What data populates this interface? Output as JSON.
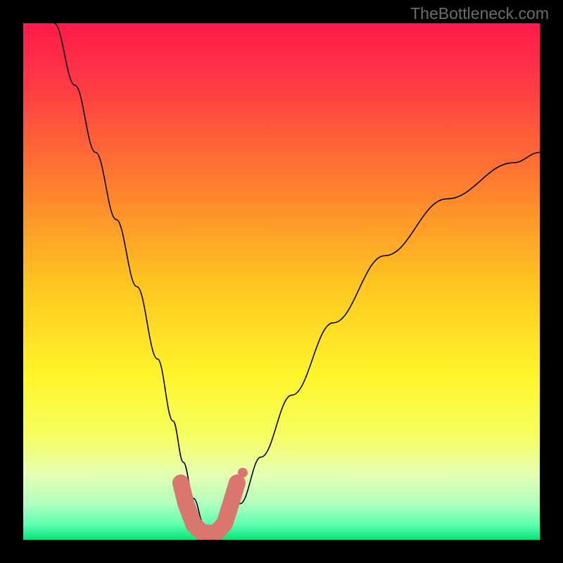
{
  "watermark": "TheBottleneck.com",
  "chart_data": {
    "type": "line",
    "title": "",
    "xlabel": "",
    "ylabel": "",
    "xlim": [
      0,
      100
    ],
    "ylim": [
      0,
      100
    ],
    "background_gradient": {
      "stops": [
        {
          "offset": 0.0,
          "color": "#ff1a4a"
        },
        {
          "offset": 0.12,
          "color": "#ff3a45"
        },
        {
          "offset": 0.3,
          "color": "#ff7a30"
        },
        {
          "offset": 0.5,
          "color": "#ffc420"
        },
        {
          "offset": 0.68,
          "color": "#fff52a"
        },
        {
          "offset": 0.8,
          "color": "#f5ff60"
        },
        {
          "offset": 0.87,
          "color": "#e8ffb0"
        },
        {
          "offset": 0.93,
          "color": "#b0ffc0"
        },
        {
          "offset": 0.97,
          "color": "#60ffb0"
        },
        {
          "offset": 1.0,
          "color": "#00e676"
        }
      ]
    },
    "series": [
      {
        "name": "bottleneck-curve",
        "stroke": "#000000",
        "stroke_width": 1.6,
        "x": [
          6,
          10,
          14,
          18,
          22,
          26,
          29,
          31,
          33,
          35,
          36,
          38,
          40,
          42,
          46,
          52,
          60,
          70,
          82,
          95,
          100
        ],
        "values": [
          100,
          88,
          75,
          62,
          49,
          35,
          23,
          15,
          8,
          3,
          1,
          1,
          3,
          7,
          16,
          28,
          42,
          55,
          66,
          73,
          75
        ]
      }
    ],
    "markers": {
      "name": "optimal-range-overlay",
      "color": "#d9776f",
      "x": [
        30.5,
        31.5,
        33.0,
        34.5,
        36.0,
        37.5,
        39.0,
        40.2,
        41.4
      ],
      "values": [
        11.0,
        7.0,
        3.0,
        1.5,
        1.2,
        1.5,
        3.2,
        7.0,
        11.0
      ],
      "radius": [
        6,
        7,
        8,
        8,
        8,
        8,
        8,
        7,
        6
      ]
    }
  }
}
